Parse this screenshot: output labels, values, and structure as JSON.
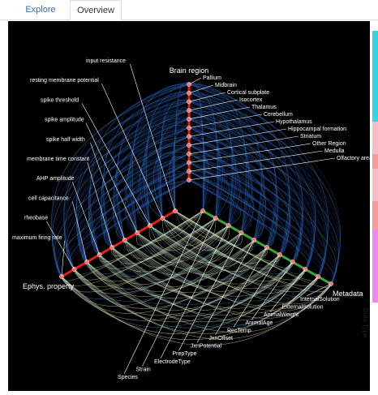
{
  "tabs": {
    "explore": "Explore",
    "overview": "Overview"
  },
  "legend": {
    "title": "Data Type"
  },
  "axes": {
    "brain": {
      "title": "Brain region",
      "items": [
        "Pallium",
        "Midbrain",
        "Cortical subplate",
        "Isocortex",
        "Thalamus",
        "Cerebellum",
        "Hypothalamus",
        "Hippocampal formation",
        "Striatum",
        "Other Region",
        "Medulla",
        "Olfactory areas"
      ]
    },
    "ephys": {
      "title": "Ephys. property",
      "items": [
        "input resistance",
        "resting membrane potential",
        "spike threshold",
        "spike amplitude",
        "spike half width",
        "membrane time constant",
        "AHP amplitude",
        "cell capacitance",
        "rheobase",
        "maximum firing rate"
      ]
    },
    "meta": {
      "title": "Metadata",
      "items": [
        "Species",
        "Strain",
        "ElectrodeType",
        "PrepType",
        "JxnPotential",
        "JxnOffset",
        "RecTemp",
        "AnimalAge",
        "AnimalWeight",
        "ExternalSolution",
        "InternalSolution"
      ]
    }
  },
  "colors": {
    "brain_axis": "#e0201c",
    "ephys_axis": "#e0201c",
    "meta_axis": "#3ca83c",
    "node": "#ff6a5c",
    "link_dark": "#1a3a8a",
    "link_mid": "#3a8fd6",
    "link_light": "#f4f7c0"
  }
}
